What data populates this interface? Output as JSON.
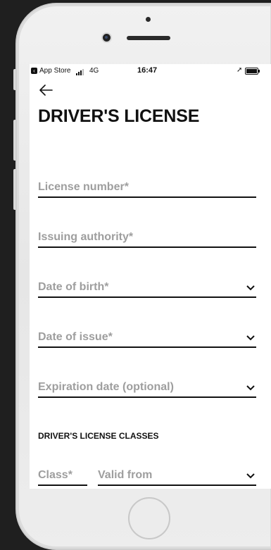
{
  "statusbar": {
    "back_app": "App Store",
    "network": "4G",
    "time": "16:47"
  },
  "page": {
    "title": "DRIVER'S LICENSE"
  },
  "fields": {
    "license_number": "License number*",
    "issuing_authority": "Issuing authority*",
    "date_of_birth": "Date of birth*",
    "date_of_issue": "Date of issue*",
    "expiration_date": "Expiration date (optional)"
  },
  "classes": {
    "section_title": "DRIVER'S LICENSE CLASSES",
    "class_label": "Class*",
    "valid_from_label": "Valid from"
  },
  "icons": {
    "back": "arrow-left-icon",
    "dropdown": "chevron-down-icon",
    "location": "location-arrow-icon",
    "battery": "battery-icon"
  }
}
